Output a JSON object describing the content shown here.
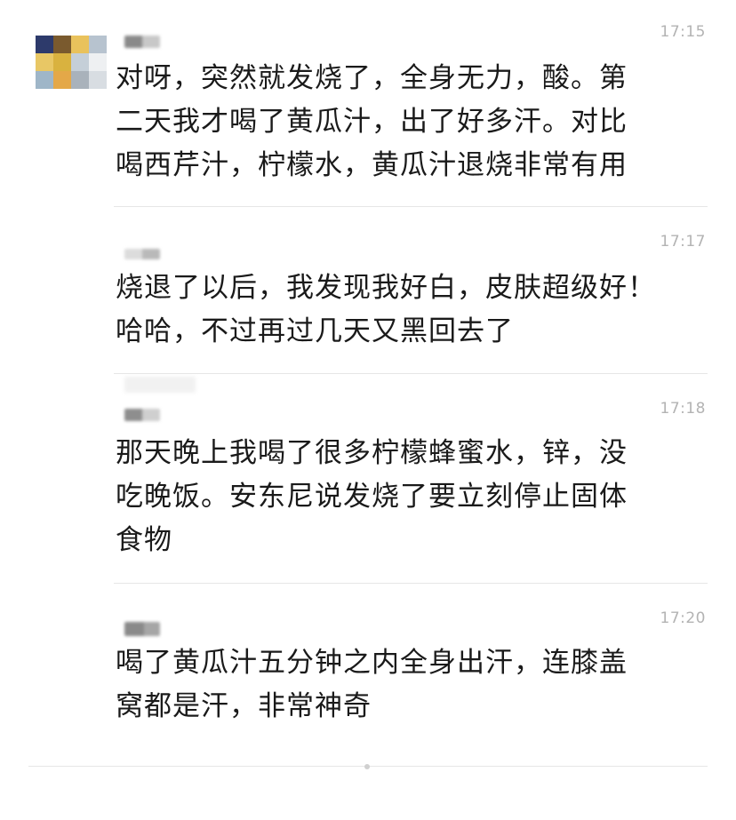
{
  "colors": {
    "background": "#ffffff",
    "text": "#1a1a1a",
    "timestamp": "#b3b3b3",
    "divider": "#e6e6e6"
  },
  "messages": [
    {
      "time": "17:15",
      "text": "对呀，突然就发烧了，全身无力，酸。第\n二天我才喝了黄瓜汁，出了好多汗。对比\n喝西芹汁，柠檬水，黄瓜汁退烧非常有用"
    },
    {
      "time": "17:17",
      "text": "烧退了以后，我发现我好白，皮肤超级好！\n哈哈，不过再过几天又黑回去了"
    },
    {
      "time": "17:18",
      "text": "那天晚上我喝了很多柠檬蜂蜜水，锌，没\n吃晚饭。安东尼说发烧了要立刻停止固体\n食物"
    },
    {
      "time": "17:20",
      "text": "喝了黄瓜汁五分钟之内全身出汗，连膝盖\n窝都是汗，非常神奇"
    }
  ]
}
